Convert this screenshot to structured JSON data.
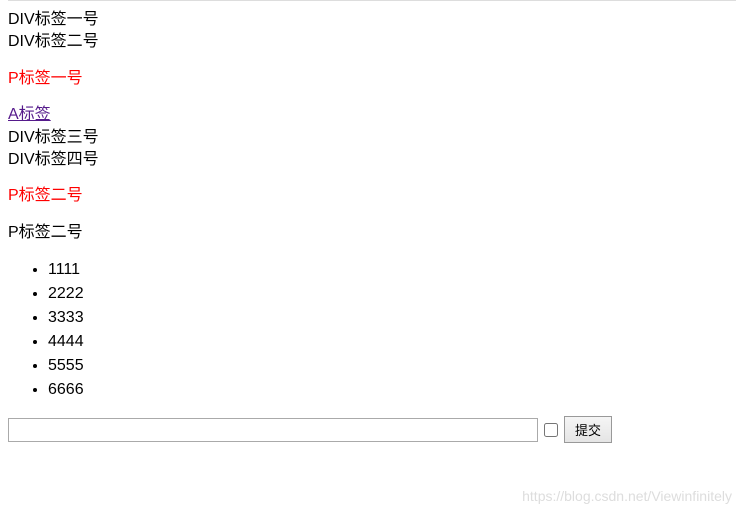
{
  "divs": {
    "div1": "DIV标签一号",
    "div2": "DIV标签二号",
    "div3": "DIV标签三号",
    "div4": "DIV标签四号"
  },
  "paragraphs": {
    "p1_red": "P标签一号",
    "p2_red": "P标签二号",
    "p2_black": "P标签二号"
  },
  "link": {
    "a1": "A标签"
  },
  "list": {
    "items": [
      "1111",
      "2222",
      "3333",
      "4444",
      "5555",
      "6666"
    ]
  },
  "form": {
    "text_value": "",
    "submit_label": "提交"
  },
  "watermark": "https://blog.csdn.net/Viewinfinitely"
}
